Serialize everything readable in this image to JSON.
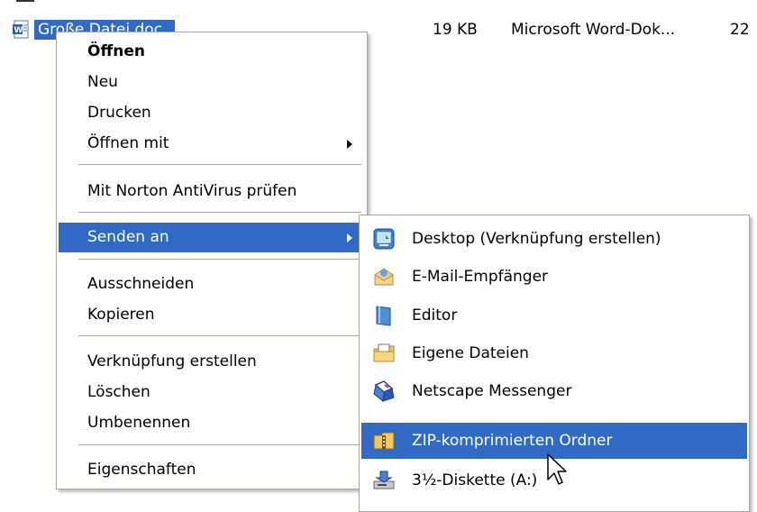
{
  "file": {
    "name": "Große Datei.doc",
    "size": "19 KB",
    "type": "Microsoft Word-Dok...",
    "date": "22",
    "icon": "word-document-icon"
  },
  "context_menu": {
    "items": [
      {
        "label": "Öffnen",
        "bold": true
      },
      {
        "label": "Neu"
      },
      {
        "label": "Drucken"
      },
      {
        "label": "Öffnen mit",
        "submenu": true
      },
      {
        "label": "Mit Norton AntiVirus prüfen"
      },
      {
        "label": "Senden an",
        "submenu": true,
        "highlighted": true
      },
      {
        "label": "Ausschneiden"
      },
      {
        "label": "Kopieren"
      },
      {
        "label": "Verknüpfung erstellen"
      },
      {
        "label": "Löschen"
      },
      {
        "label": "Umbenennen"
      },
      {
        "label": "Eigenschaften"
      }
    ]
  },
  "send_to_menu": {
    "items": [
      {
        "label": "Desktop (Verknüpfung erstellen)",
        "icon": "desktop-icon"
      },
      {
        "label": "E-Mail-Empfänger",
        "icon": "mail-envelope-icon"
      },
      {
        "label": "Editor",
        "icon": "notepad-icon"
      },
      {
        "label": "Eigene Dateien",
        "icon": "my-documents-folder-icon"
      },
      {
        "label": "Netscape Messenger",
        "icon": "netscape-messenger-icon"
      },
      {
        "label": "ZIP-komprimierten Ordner",
        "icon": "zip-folder-icon",
        "highlighted": true
      },
      {
        "label": "3½-Diskette (A:)",
        "icon": "floppy-drive-icon"
      }
    ]
  },
  "colors": {
    "highlight": "#316ac5",
    "menu_border": "#aca899"
  }
}
